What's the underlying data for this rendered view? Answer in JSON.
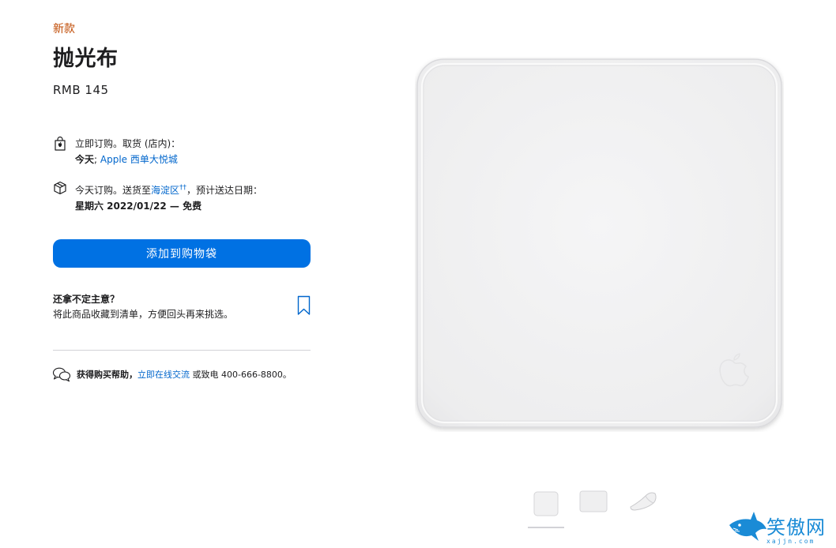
{
  "product": {
    "badge": "新款",
    "title": "抛光布",
    "price": "RMB 145"
  },
  "pickup": {
    "line1": "立即订购。取货 (店内)：",
    "line2_bold": "今天",
    "line2_sep": "; ",
    "store_link": "Apple 西单大悦城",
    "icon": "store-bag-icon"
  },
  "delivery": {
    "line1_prefix": "今天订购。送货至",
    "district_link": "海淀区",
    "footnote": "††",
    "line1_suffix": "，预计送达日期：",
    "line2": "星期六 2022/01/22 — 免费",
    "icon": "box-icon"
  },
  "add_to_bag": "添加到购物袋",
  "save": {
    "title": "还拿不定主意？",
    "desc": "将此商品收藏到清单，方便回头再来挑选。",
    "icon": "bookmark-icon"
  },
  "help": {
    "bold": "获得购买帮助，",
    "chat_link": "立即在线交流",
    "suffix": " 或致电 400-666-8800。",
    "icon": "chat-bubbles-icon"
  },
  "gallery": {
    "thumbnails": [
      "polishing-cloth-front",
      "polishing-cloth-flat",
      "polishing-cloth-folded"
    ],
    "selected_index": 0
  },
  "watermark": {
    "text": "笑傲网",
    "sub": "xajjn.com"
  },
  "colors": {
    "accent": "#0071e3",
    "link": "#0066cc",
    "badge": "#bf4800"
  }
}
